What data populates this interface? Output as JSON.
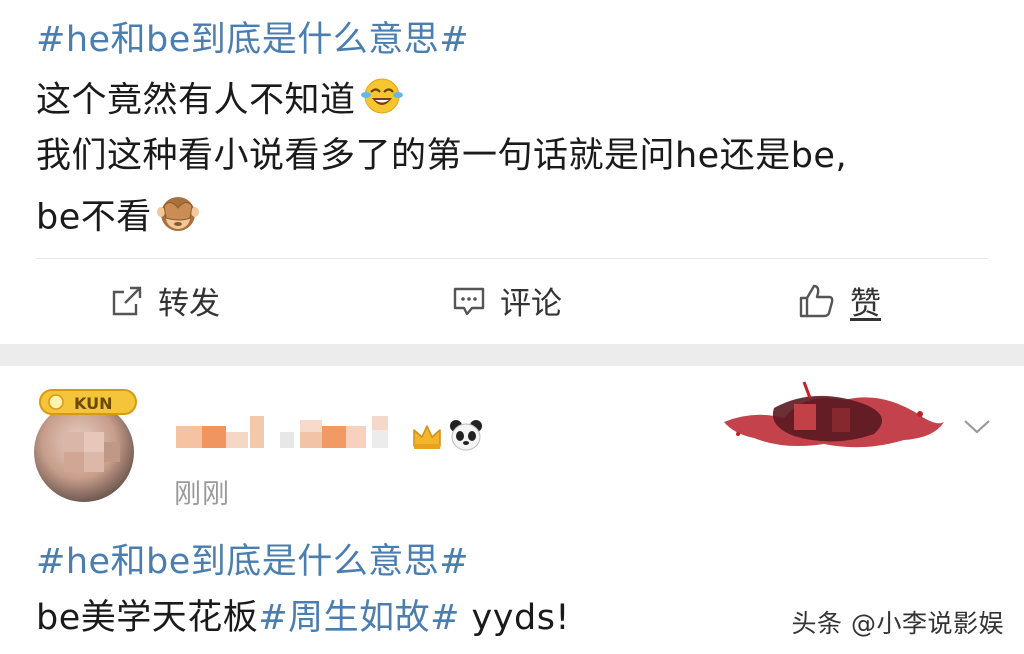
{
  "post1": {
    "hashtag": "#he和be到底是什么意思#",
    "line1": "这个竟然有人不知道",
    "line2": "我们这种看小说看多了的第一句话就是问he还是be,",
    "line3": "be不看"
  },
  "actions": {
    "repost": "转发",
    "comment": "评论",
    "like": "赞"
  },
  "post2": {
    "badge_text": "KUN",
    "time": "刚刚",
    "hashtag": "#he和be到底是什么意思#",
    "body_prefix": "be美学天花板",
    "body_tag": "#周生如故#",
    "body_suffix": " yyds!"
  },
  "watermark": "头条 @小李说影娱",
  "colors": {
    "hashtag": "#4a7db0",
    "separator": "#ececec"
  },
  "icons": [
    "laughing-crying-emoji",
    "see-no-evil-monkey-emoji",
    "repost-icon",
    "comment-icon",
    "thumbs-up-icon",
    "crown-icon",
    "panda-icon",
    "chevron-down-icon"
  ]
}
